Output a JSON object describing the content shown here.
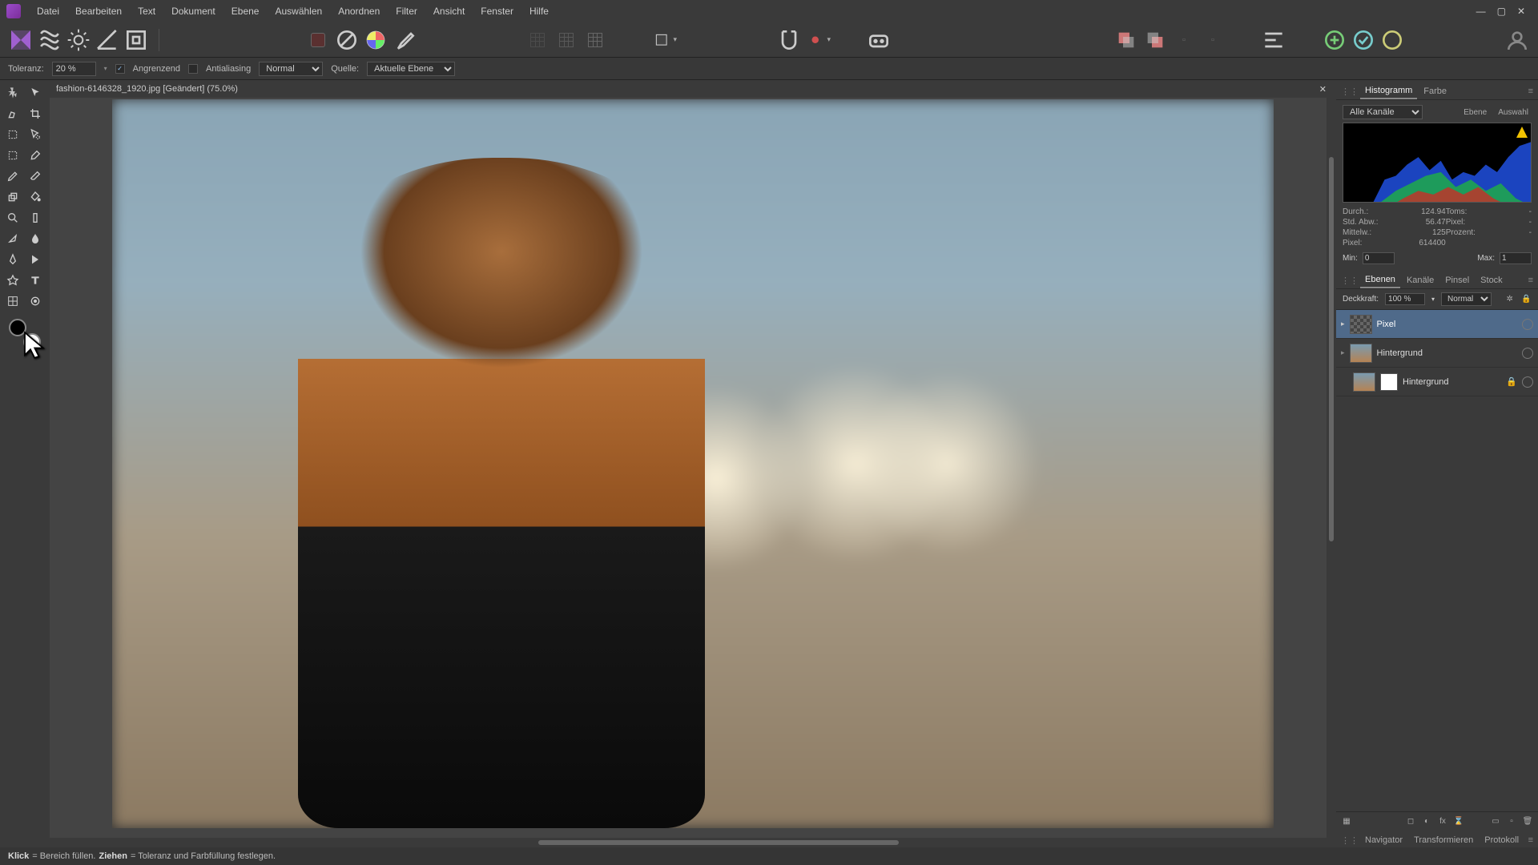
{
  "menu": [
    "Datei",
    "Bearbeiten",
    "Text",
    "Dokument",
    "Ebene",
    "Auswählen",
    "Anordnen",
    "Filter",
    "Ansicht",
    "Fenster",
    "Hilfe"
  ],
  "contextbar": {
    "tolerance_label": "Toleranz:",
    "tolerance_value": "20 %",
    "contiguous": "Angrenzend",
    "contiguous_checked": true,
    "antialias": "Antialiasing",
    "antialias_checked": false,
    "blend_mode": "Normal",
    "source_label": "Quelle:",
    "source_value": "Aktuelle Ebene"
  },
  "document_tab": "fashion-6146328_1920.jpg [Geändert] (75.0%)",
  "histo_panel": {
    "tabs": [
      "Histogramm",
      "Farbe"
    ],
    "channel_select": "Alle Kanäle",
    "scope_labels": [
      "Ebene",
      "Auswahl"
    ],
    "stats": {
      "mean_label": "Durch.:",
      "mean_val": "124.94",
      "std_label": "Std. Abw.:",
      "std_val": "56.47",
      "median_label": "Mittelw.:",
      "median_val": "125",
      "pixels_label": "Pixel:",
      "pixels_val": "614400",
      "tones_label": "Toms:",
      "tones_val": "-",
      "pxcount_label": "Pixel:",
      "pxcount_val": "-",
      "percent_label": "Prozent:",
      "percent_val": "-"
    },
    "min_label": "Min:",
    "min_val": "0",
    "max_label": "Max:",
    "max_val": "1"
  },
  "layers_panel": {
    "tabs": [
      "Ebenen",
      "Kanäle",
      "Pinsel",
      "Stock"
    ],
    "opacity_label": "Deckkraft:",
    "opacity_value": "100 %",
    "blend_value": "Normal",
    "layers": [
      {
        "name": "Pixel",
        "selected": true,
        "thumb": "checker",
        "mask": false,
        "locked": false
      },
      {
        "name": "Hintergrund",
        "selected": false,
        "thumb": "img",
        "mask": false,
        "locked": false
      },
      {
        "name": "Hintergrund",
        "selected": false,
        "thumb": "img",
        "mask": true,
        "locked": true
      }
    ]
  },
  "bottom_tabs": [
    "Navigator",
    "Transformieren",
    "Protokoll"
  ],
  "statusbar": {
    "click": "Klick",
    "click_text": " = Bereich füllen. ",
    "drag": "Ziehen",
    "drag_text": " = Toleranz und Farbfüllung festlegen."
  },
  "colors": {
    "accent": "#4f6a8a"
  }
}
